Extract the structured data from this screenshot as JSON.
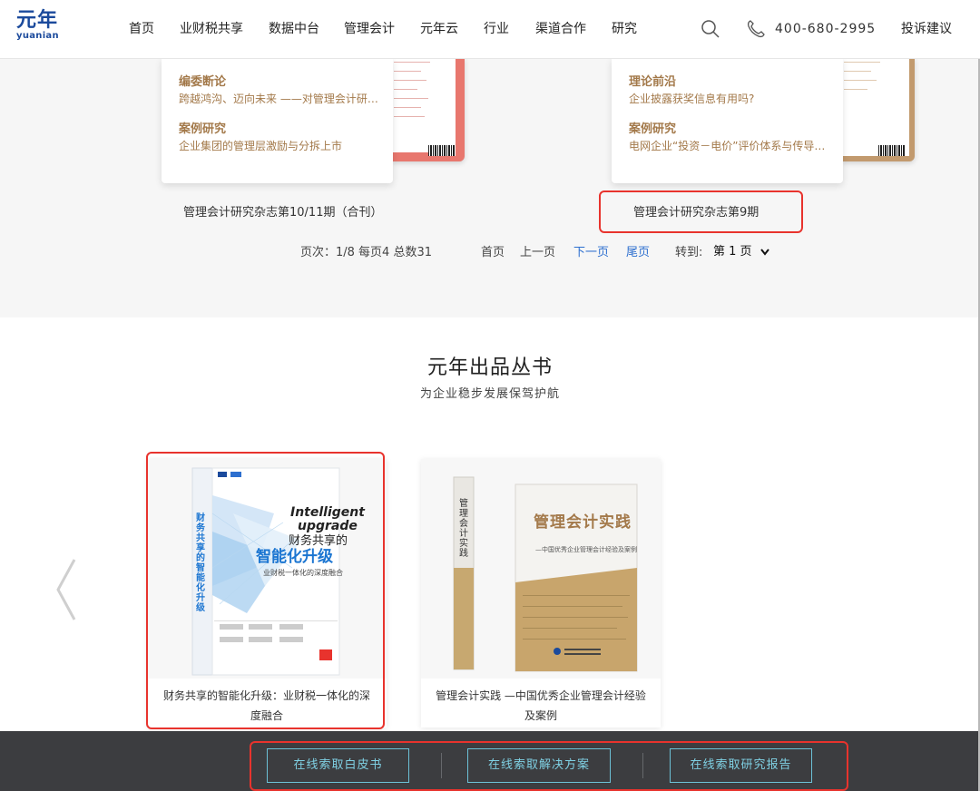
{
  "header": {
    "logo_cn": "元年",
    "logo_en": "yuanian",
    "nav": [
      "首页",
      "业财税共享",
      "数据中台",
      "管理会计",
      "元年云",
      "行业",
      "渠道合作",
      "研究"
    ],
    "phone": "400-680-2995",
    "complaint": "投诉建议"
  },
  "magazines": [
    {
      "sections": [
        {
          "title": "编委断论",
          "subtitle": "跨越鸿沟、迈向未来 ——对管理会计研…"
        },
        {
          "title": "案例研究",
          "subtitle": "企业集团的管理层激励与分拆上市"
        }
      ],
      "caption": "管理会计研究杂志第10/11期（合刊）"
    },
    {
      "sections": [
        {
          "title": "理论前沿",
          "subtitle": "企业披露获奖信息有用吗?"
        },
        {
          "title": "案例研究",
          "subtitle": "电网企业“投资－电价”评价体系与传导…"
        }
      ],
      "caption": "管理会计研究杂志第9期"
    }
  ],
  "pager": {
    "info": "页次：1/8  每页4  总数31",
    "first": "首页",
    "prev": "上一页",
    "next": "下一页",
    "last": "尾页",
    "goto_label": "转到:",
    "goto_value": "第 1 页"
  },
  "books": {
    "title": "元年出品丛书",
    "subtitle": "为企业稳步发展保驾护航",
    "items": [
      {
        "caption": "财务共享的智能化升级：业财税一体化的深度融合",
        "cover_line1": "Intelligent",
        "cover_line2": "upgrade",
        "cover_title": "财务共享的",
        "cover_main": "智能化升级",
        "cover_sub": "业财税一体化的深度融合",
        "spine": "财务共享的智能化升级"
      },
      {
        "caption": "管理会计实践 —中国优秀企业管理会计经验及案例",
        "cover_main": "管理会计实践",
        "cover_sub": "—中国优秀企业管理会计经验及案例",
        "spine": "管理会计实践"
      }
    ]
  },
  "cta": [
    "在线索取白皮书",
    "在线索取解决方案",
    "在线索取研究报告"
  ],
  "colors": {
    "accent_blue": "#2d6fcf",
    "highlight_red": "#e8332d",
    "gold": "#a3794a",
    "cta_cyan": "#7fd0e3",
    "footer_bg": "#3c3d40"
  }
}
